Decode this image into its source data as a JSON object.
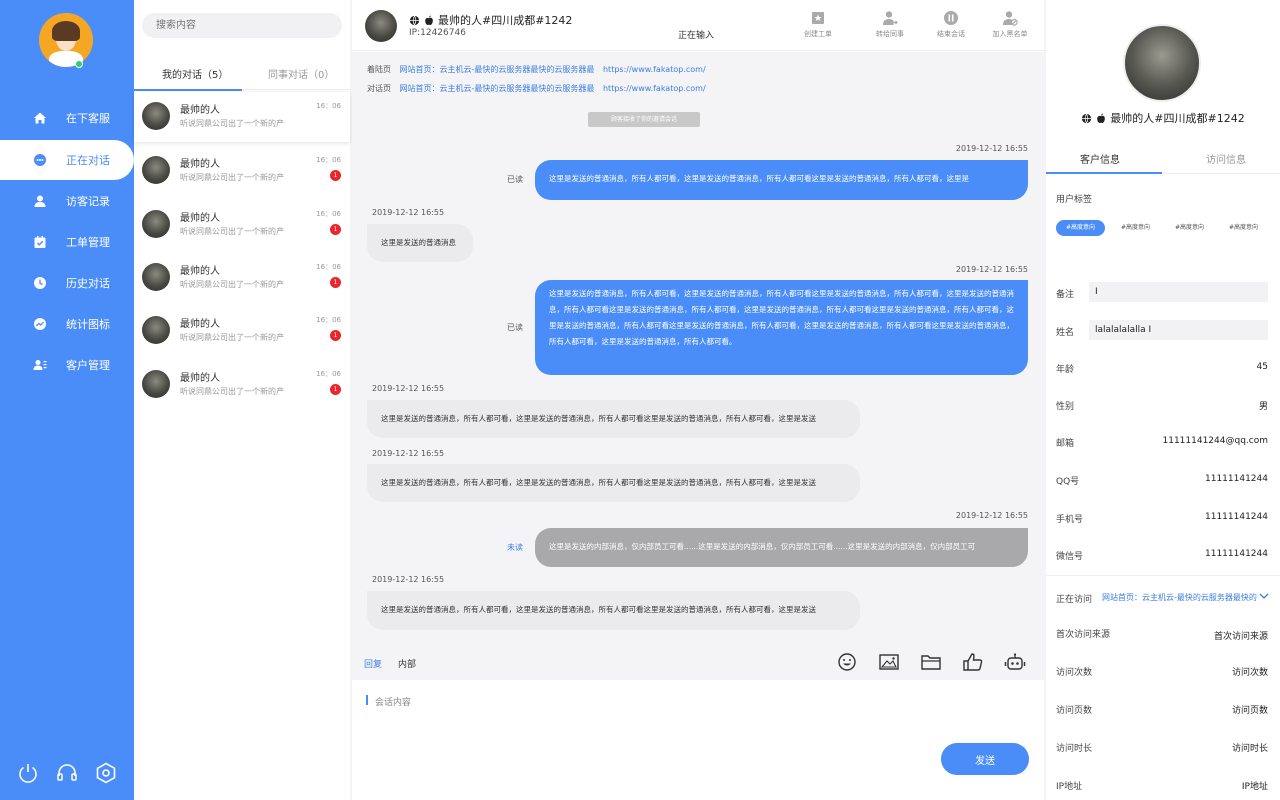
{
  "nav": {
    "items": [
      {
        "label": "在下客服",
        "icon": "home-icon"
      },
      {
        "label": "正在对话",
        "icon": "chat-icon"
      },
      {
        "label": "访客记录",
        "icon": "user-icon"
      },
      {
        "label": "工单管理",
        "icon": "ticket-icon"
      },
      {
        "label": "历史对话",
        "icon": "clock-icon"
      },
      {
        "label": "统计图标",
        "icon": "chart-icon"
      },
      {
        "label": "客户管理",
        "icon": "contacts-icon"
      }
    ],
    "active_index": 1,
    "bottom_icons": [
      "power-icon",
      "headset-icon",
      "settings-icon"
    ]
  },
  "conversations": {
    "search_placeholder": "搜索内容",
    "tabs": [
      "我的对话（5）",
      "同事对话（0）"
    ],
    "items": [
      {
        "name": "最帅的人",
        "message": "听说同鼎公司出了一个新的产",
        "time": "16：06",
        "badge": ""
      },
      {
        "name": "最帅的人",
        "message": "听说同鼎公司出了一个新的产",
        "time": "16：06",
        "badge": "1"
      },
      {
        "name": "最帅的人",
        "message": "听说同鼎公司出了一个新的产",
        "time": "16：06",
        "badge": "1"
      },
      {
        "name": "最帅的人",
        "message": "听说同鼎公司出了一个新的产",
        "time": "16：06",
        "badge": "1"
      },
      {
        "name": "最帅的人",
        "message": "听说同鼎公司出了一个新的产",
        "time": "16：06",
        "badge": "1"
      },
      {
        "name": "最帅的人",
        "message": "听说同鼎公司出了一个新的产",
        "time": "16：06",
        "badge": "1"
      }
    ]
  },
  "chat": {
    "header": {
      "name": "最帅的人#四川成都#1242",
      "ip": "IP:12426746",
      "status": "正在输入",
      "actions": [
        "创建工单",
        "转给同事",
        "结束会话",
        "加入黑名单"
      ]
    },
    "landing": {
      "label": "着陆页",
      "text": "网站首页：云主机云-最快的云服务器最快的云服务器最",
      "url": "https://www.fakatop.com/"
    },
    "dialog_page": {
      "label": "对话页",
      "text": "网站首页：云主机云-最快的云服务器最快的云服务器最",
      "url": "https://www.fakatop.com/"
    },
    "system_note": "顾客接收了你的邀请会话",
    "messages": [
      {
        "side": "out",
        "time": "2019-12-12  16:55",
        "status": "已读",
        "text": "这里是发送的普通消息，所有人都可看，这里是发送的普通消息，所有人都可看这里是发送的普通消息，所有人都可看，这里是"
      },
      {
        "side": "in",
        "time": "2019-12-12  16:55",
        "text": "这里是发送的普通消息"
      },
      {
        "side": "out",
        "time": "2019-12-12  16:55",
        "status": "已读",
        "text": "这里是发送的普通消息，所有人都可看，这里是发送的普通消息，所有人都可看这里是发送的普通消息，所有人都可看，这里是发送的普通消息，所有人都可看这里是发送的普通消息，所有人都可看，这里是发送的普通消息，所有人都可看这里是发送的普通消息，所有人都可看，这里是发送的普通消息，所有人都可看这里是发送的普通消息，所有人都可看，这里是发送的普通消息，所有人都可看这里是发送的普通消息，所有人都可看，这里是发送的普通消息，所有人都可看。"
      },
      {
        "side": "in",
        "time": "2019-12-12  16:55",
        "text": "这里是发送的普通消息，所有人都可看，这里是发送的普通消息，所有人都可看这里是发送的普通消息，所有人都可看，这里是发送"
      },
      {
        "side": "in",
        "time": "2019-12-12  16:55",
        "text": "这里是发送的普通消息，所有人都可看，这里是发送的普通消息，所有人都可看这里是发送的普通消息，所有人都可看，这里是发送"
      },
      {
        "side": "internal",
        "time": "2019-12-12  16:55",
        "status": "未读",
        "text": "这里是发送的内部消息，仅内部员工可看......这里是发送的内部消息，仅内部员工可看......这里是发送的内部消息，仅内部员工可"
      },
      {
        "side": "in",
        "time": "2019-12-12  16:55",
        "text": "这里是发送的普通消息，所有人都可看，这里是发送的普通消息，所有人都可看这里是发送的普通消息，所有人都可看，这里是发送"
      }
    ],
    "toolbar": {
      "tabs": [
        "回复",
        "内部"
      ],
      "icons": [
        "emoji-icon",
        "image-icon",
        "folder-icon",
        "thumbs-up-icon",
        "robot-icon"
      ]
    },
    "composer": {
      "placeholder": "会话内容",
      "send_label": "发送"
    }
  },
  "customer": {
    "name": "最帅的人#四川成都#1242",
    "tabs": [
      "客户信息",
      "访问信息"
    ],
    "tags_label": "用户标签",
    "tags": [
      "#高度意向",
      "#高度意向",
      "#高度意向",
      "#高度意向"
    ],
    "remark_label": "备注",
    "remark_value": "I",
    "name_label": "姓名",
    "name_value": "lalalalalalla I",
    "fields": [
      {
        "label": "年龄",
        "value": "45"
      },
      {
        "label": "性别",
        "value": "男"
      },
      {
        "label": "邮箱",
        "value": "11111141244@qq.com"
      },
      {
        "label": "QQ号",
        "value": "11111141244"
      },
      {
        "label": "手机号",
        "value": "11111141244"
      },
      {
        "label": "微信号",
        "value": "11111141244"
      }
    ],
    "visiting_label": "正在访问",
    "visiting_value": "网站首页：云主机云-最快的云服务器最快的",
    "visit_fields": [
      {
        "label": "首次访问来源",
        "value": "首次访问来源"
      },
      {
        "label": "访问次数",
        "value": "访问次数"
      },
      {
        "label": "访问页数",
        "value": "访问页数"
      },
      {
        "label": "访问时长",
        "value": "访问时长"
      },
      {
        "label": "IP地址",
        "value": "IP地址"
      }
    ]
  },
  "colors": {
    "accent": "#4b8df8",
    "badge": "#e8262c",
    "internal": "#a9a9ab",
    "panel_bg": "#f4f4f6"
  }
}
